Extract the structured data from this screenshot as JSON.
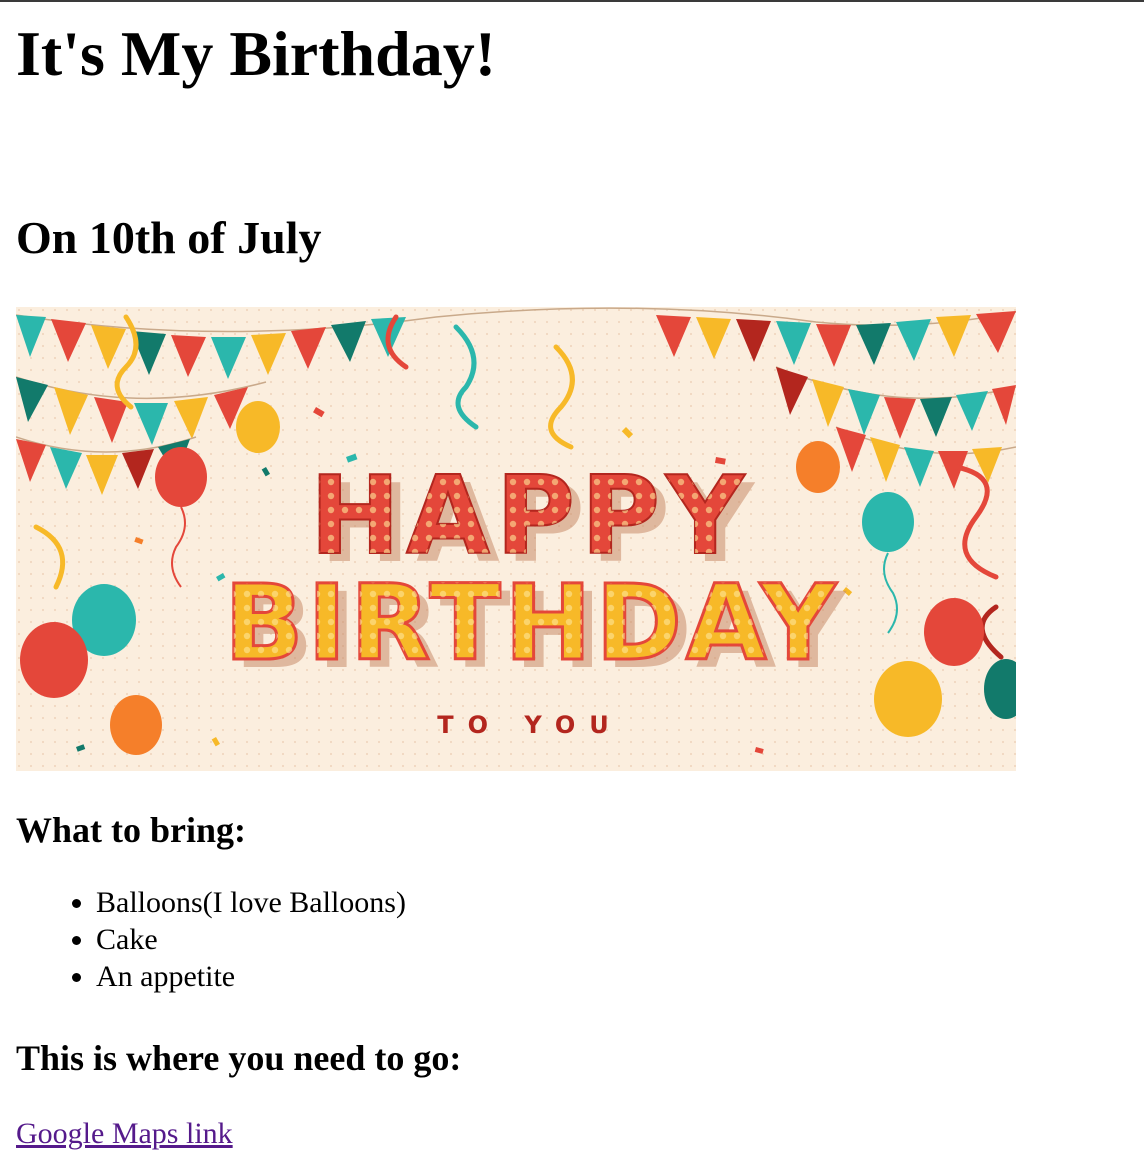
{
  "page": {
    "title": "It's My Birthday!",
    "date_heading": "On 10th of July",
    "banner": {
      "line1": "HAPPY",
      "line2": "BIRTHDAY",
      "line3": "TO YOU",
      "colors": {
        "background": "#fbeede",
        "red": "#e4473a",
        "teal": "#2bb7ac",
        "yellow": "#f7b928",
        "orange": "#f57f2a",
        "dark_teal": "#127a6b",
        "dark_red": "#b3261e"
      }
    },
    "bring_heading": "What to bring:",
    "bring_items": [
      "Balloons(I love Balloons)",
      "Cake",
      "An appetite"
    ],
    "where_heading": "This is where you need to go:",
    "maps_link": "Google Maps link"
  }
}
